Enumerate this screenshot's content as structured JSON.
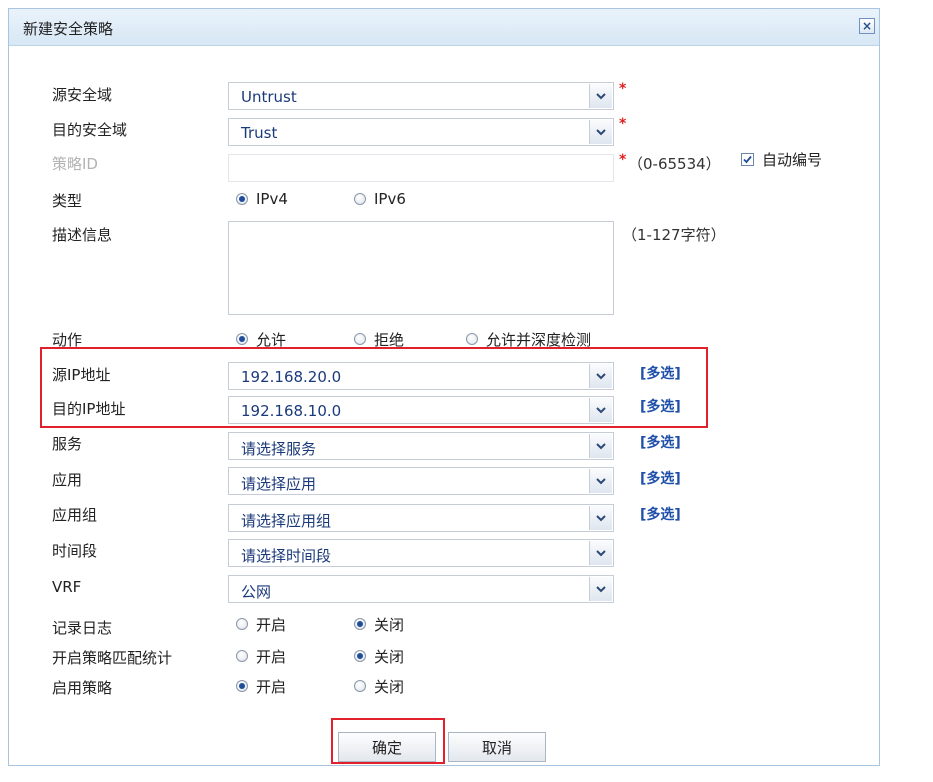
{
  "dialog": {
    "title": "新建安全策略",
    "close_icon": "×"
  },
  "form": {
    "src_zone": {
      "label": "源安全域",
      "value": "Untrust",
      "required": "*"
    },
    "dst_zone": {
      "label": "目的安全域",
      "value": "Trust",
      "required": "*"
    },
    "policy_id": {
      "label": "策略ID",
      "value": "",
      "required": "*",
      "hint": "（0-65534）",
      "auto_label": "自动编号",
      "auto_checked": true
    },
    "type": {
      "label": "类型",
      "options": [
        "IPv4",
        "IPv6"
      ],
      "selected": "IPv4"
    },
    "description": {
      "label": "描述信息",
      "value": "",
      "hint": "（1-127字符）"
    },
    "action": {
      "label": "动作",
      "options": [
        "允许",
        "拒绝",
        "允许并深度检测"
      ],
      "selected": "允许"
    },
    "src_ip": {
      "label": "源IP地址",
      "value": "192.168.20.0",
      "multi": "[多选]"
    },
    "dst_ip": {
      "label": "目的IP地址",
      "value": "192.168.10.0",
      "multi": "[多选]"
    },
    "service": {
      "label": "服务",
      "value": "请选择服务",
      "multi": "[多选]"
    },
    "app": {
      "label": "应用",
      "value": "请选择应用",
      "multi": "[多选]"
    },
    "app_group": {
      "label": "应用组",
      "value": "请选择应用组",
      "multi": "[多选]"
    },
    "time_range": {
      "label": "时间段",
      "value": "请选择时间段"
    },
    "vrf": {
      "label": "VRF",
      "value": "公网"
    },
    "logging": {
      "label": "记录日志",
      "options": [
        "开启",
        "关闭"
      ],
      "selected": "关闭"
    },
    "stats": {
      "label": "开启策略匹配统计",
      "options": [
        "开启",
        "关闭"
      ],
      "selected": "关闭"
    },
    "enable": {
      "label": "启用策略",
      "options": [
        "开启",
        "关闭"
      ],
      "selected": "开启"
    }
  },
  "buttons": {
    "ok": "确定",
    "cancel": "取消"
  },
  "colors": {
    "highlight": "#e0212b",
    "link": "#1f4fa8",
    "value_text": "#1b3a7a",
    "required": "#e02020"
  }
}
